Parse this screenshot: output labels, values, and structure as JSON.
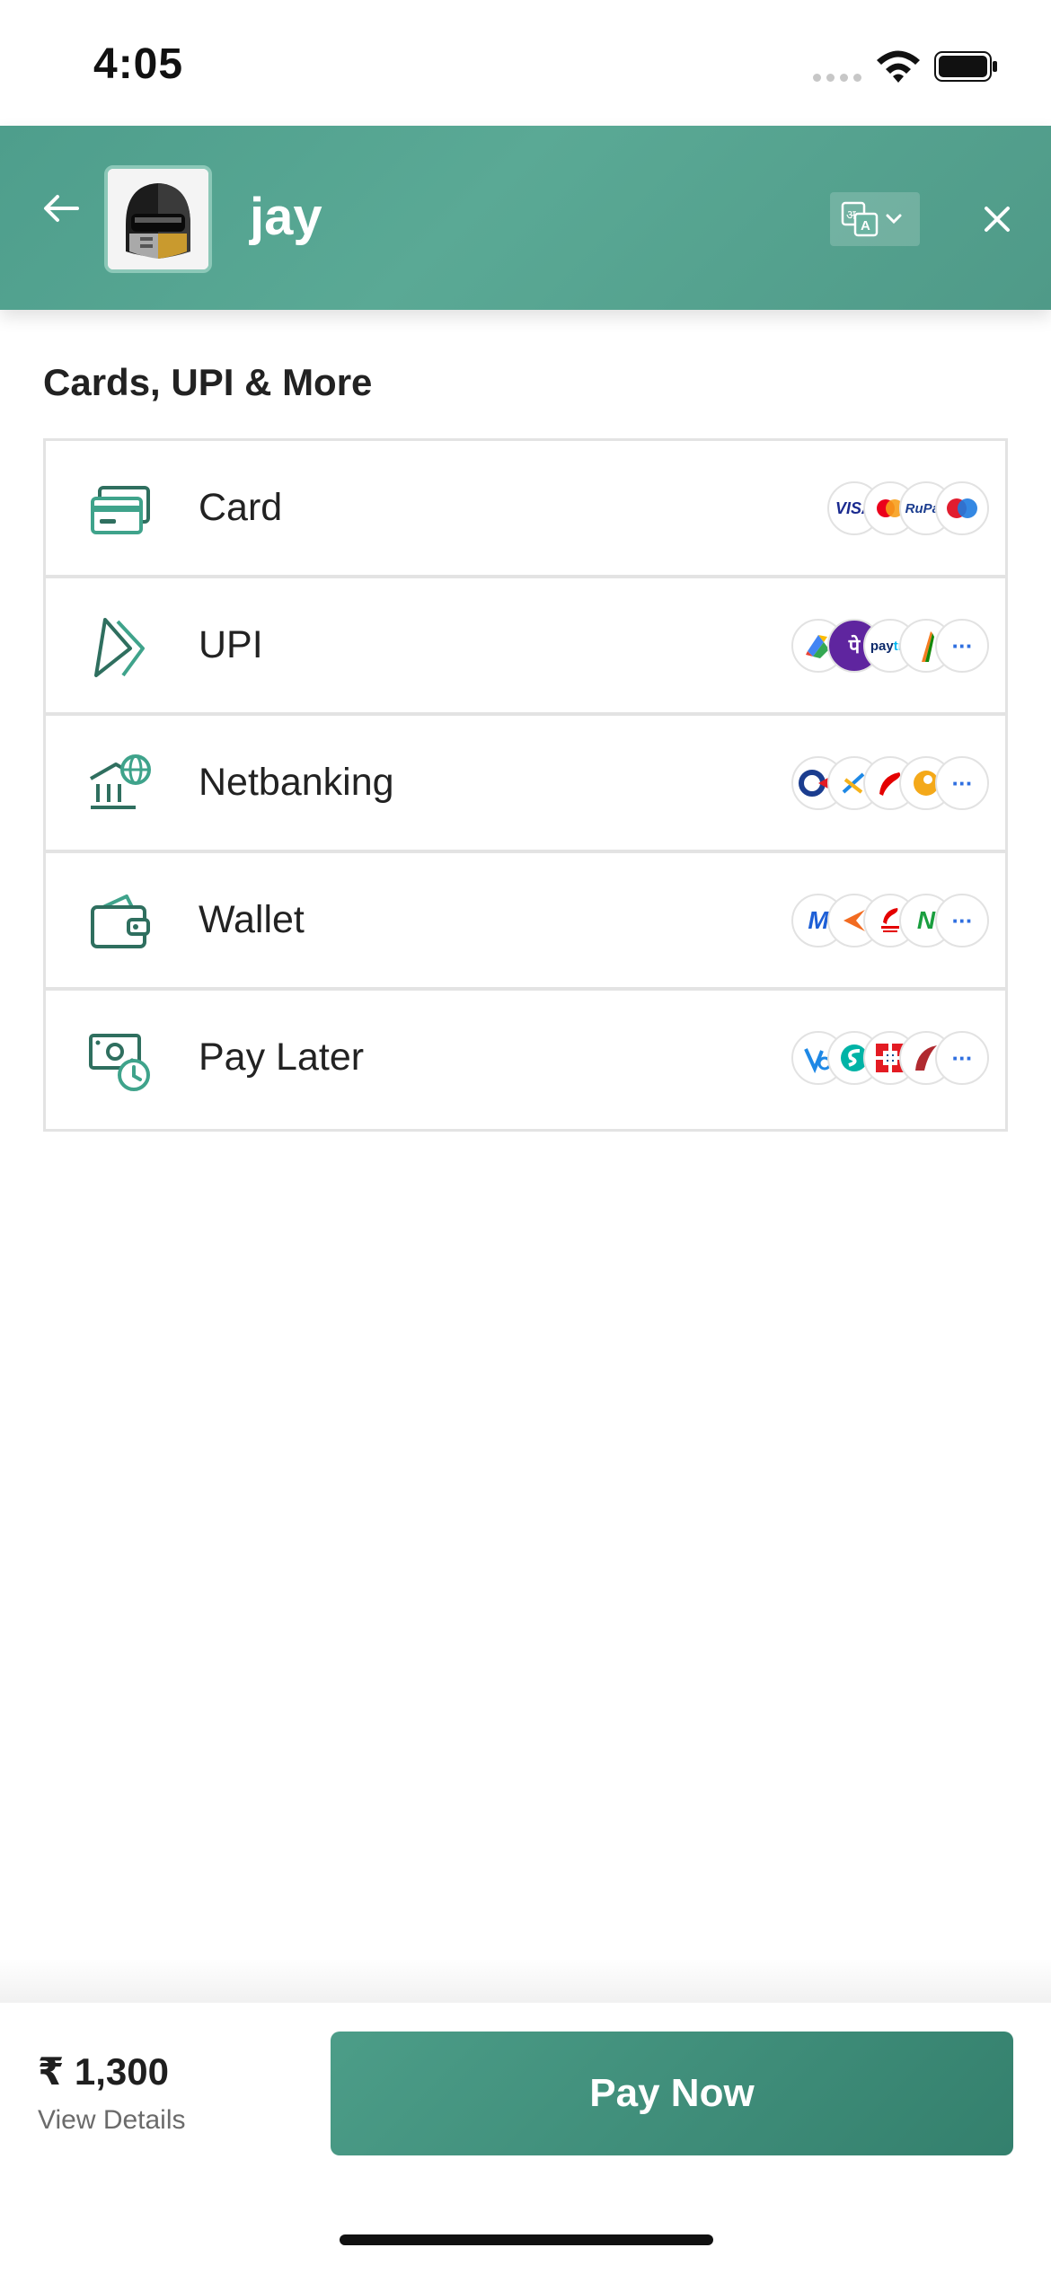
{
  "status_bar": {
    "time": "4:05"
  },
  "header": {
    "merchant_name": "jay",
    "back_icon": "arrow-left-icon",
    "language_icon": "translate-icon",
    "close_icon": "close-icon"
  },
  "section": {
    "title": "Cards, UPI & More"
  },
  "methods": [
    {
      "label": "Card",
      "icon": "card-icon",
      "logos": [
        "VISA",
        "Mastercard",
        "RuPay",
        "Maestro"
      ],
      "more": false
    },
    {
      "label": "UPI",
      "icon": "upi-icon",
      "logos": [
        "Google Pay",
        "PhonePe",
        "Paytm",
        "BHIM"
      ],
      "more": true
    },
    {
      "label": "Netbanking",
      "icon": "bank-icon",
      "logos": [
        "Citi",
        "SBI",
        "Airtel",
        "Bank"
      ],
      "more": true
    },
    {
      "label": "Wallet",
      "icon": "wallet-icon",
      "logos": [
        "Mobikwik",
        "Freecharge",
        "Paytm",
        "Nxt"
      ],
      "more": true
    },
    {
      "label": "Pay Later",
      "icon": "paylater-icon",
      "logos": [
        "ePayLater",
        "Simpl",
        "HDFC",
        "ICICI"
      ],
      "more": true
    }
  ],
  "more_symbol": "···",
  "footer": {
    "amount": "₹ 1,300",
    "view_details": "View Details",
    "pay_button": "Pay Now"
  },
  "colors": {
    "accent": "#4e9e8c",
    "button": "#3b8a76"
  }
}
